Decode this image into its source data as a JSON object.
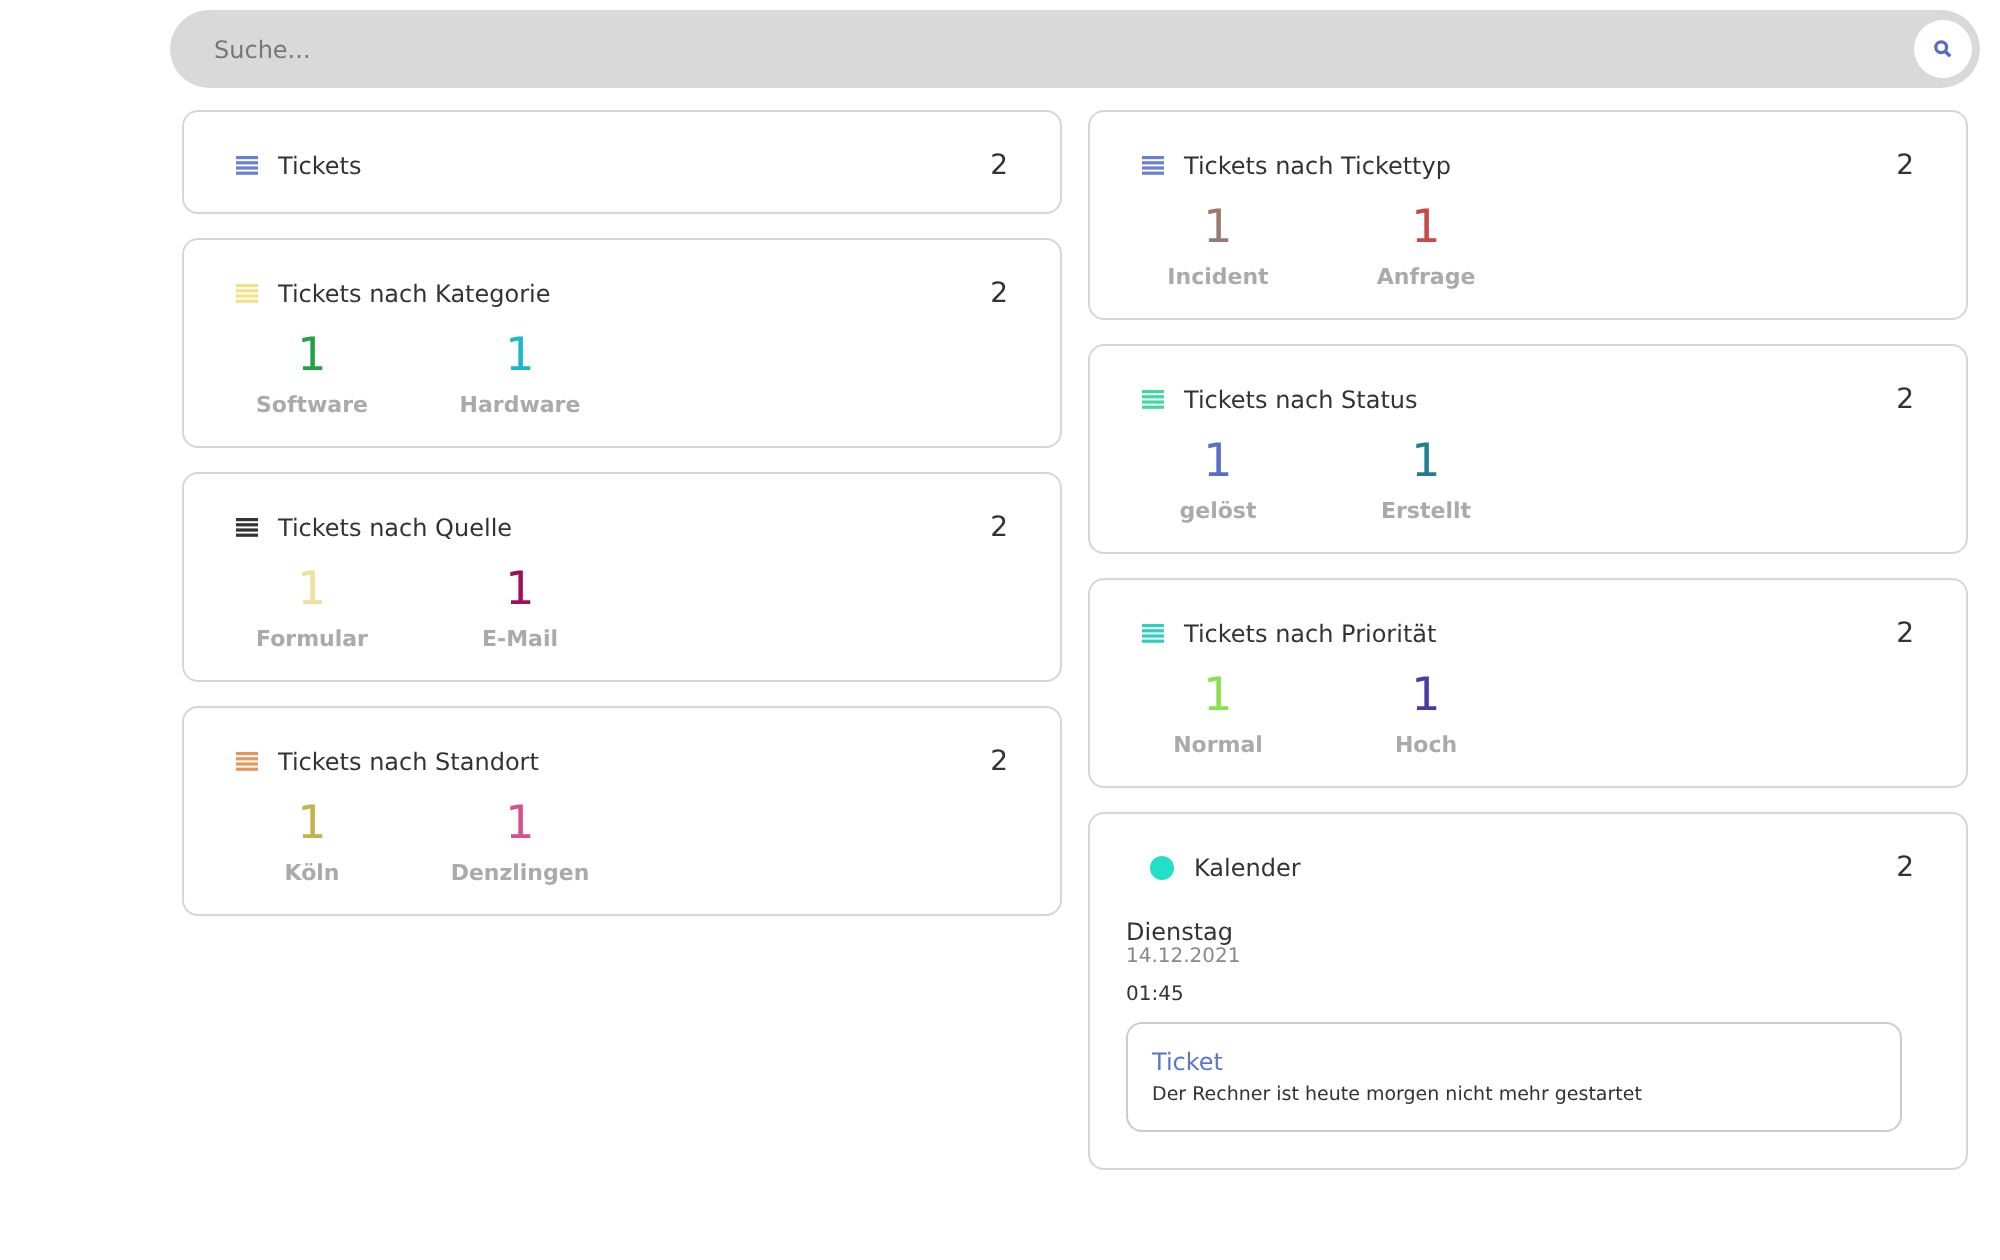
{
  "search": {
    "placeholder": "Suche..."
  },
  "columns": [
    [
      {
        "kind": "list",
        "title": "Tickets",
        "count": "2",
        "color": "#6b7fd0"
      },
      {
        "kind": "list",
        "title": "Tickets nach Kategorie",
        "count": "2",
        "color": "#f3e08a",
        "stats": [
          {
            "value": "1",
            "label": "Software",
            "color": "#1fa34a"
          },
          {
            "value": "1",
            "label": "Hardware",
            "color": "#1ab8d0"
          }
        ]
      },
      {
        "kind": "list",
        "title": "Tickets nach Quelle",
        "count": "2",
        "color": "#333333",
        "stats": [
          {
            "value": "1",
            "label": "Formular",
            "color": "#efe09a"
          },
          {
            "value": "1",
            "label": "E-Mail",
            "color": "#a0105a"
          }
        ]
      },
      {
        "kind": "list",
        "title": "Tickets nach Standort",
        "count": "2",
        "color": "#e8955a",
        "stats": [
          {
            "value": "1",
            "label": "Köln",
            "color": "#c4b24a"
          },
          {
            "value": "1",
            "label": "Denzlingen",
            "color": "#d94f8f"
          }
        ]
      }
    ],
    [
      {
        "kind": "list",
        "title": "Tickets nach Tickettyp",
        "count": "2",
        "color": "#6b7fd0",
        "stats": [
          {
            "value": "1",
            "label": "Incident",
            "color": "#9a7a6e"
          },
          {
            "value": "1",
            "label": "Anfrage",
            "color": "#c84a48"
          }
        ]
      },
      {
        "kind": "list",
        "title": "Tickets nach Status",
        "count": "2",
        "color": "#3ed9a0",
        "stats": [
          {
            "value": "1",
            "label": "gelöst",
            "color": "#5a6cc8"
          },
          {
            "value": "1",
            "label": "Erstellt",
            "color": "#1e7f95"
          }
        ]
      },
      {
        "kind": "list",
        "title": "Tickets nach Priorität",
        "count": "2",
        "color": "#2fcfc0",
        "stats": [
          {
            "value": "1",
            "label": "Normal",
            "color": "#8ae04a"
          },
          {
            "value": "1",
            "label": "Hoch",
            "color": "#4a3aa8"
          }
        ]
      },
      {
        "kind": "calendar",
        "title": "Kalender",
        "count": "2",
        "color": "#22e0c8",
        "day": "Dienstag",
        "date": "14.12.2021",
        "time": "01:45",
        "event": {
          "title": "Ticket",
          "text": "Der Rechner ist heute morgen nicht mehr gestartet"
        }
      }
    ]
  ]
}
